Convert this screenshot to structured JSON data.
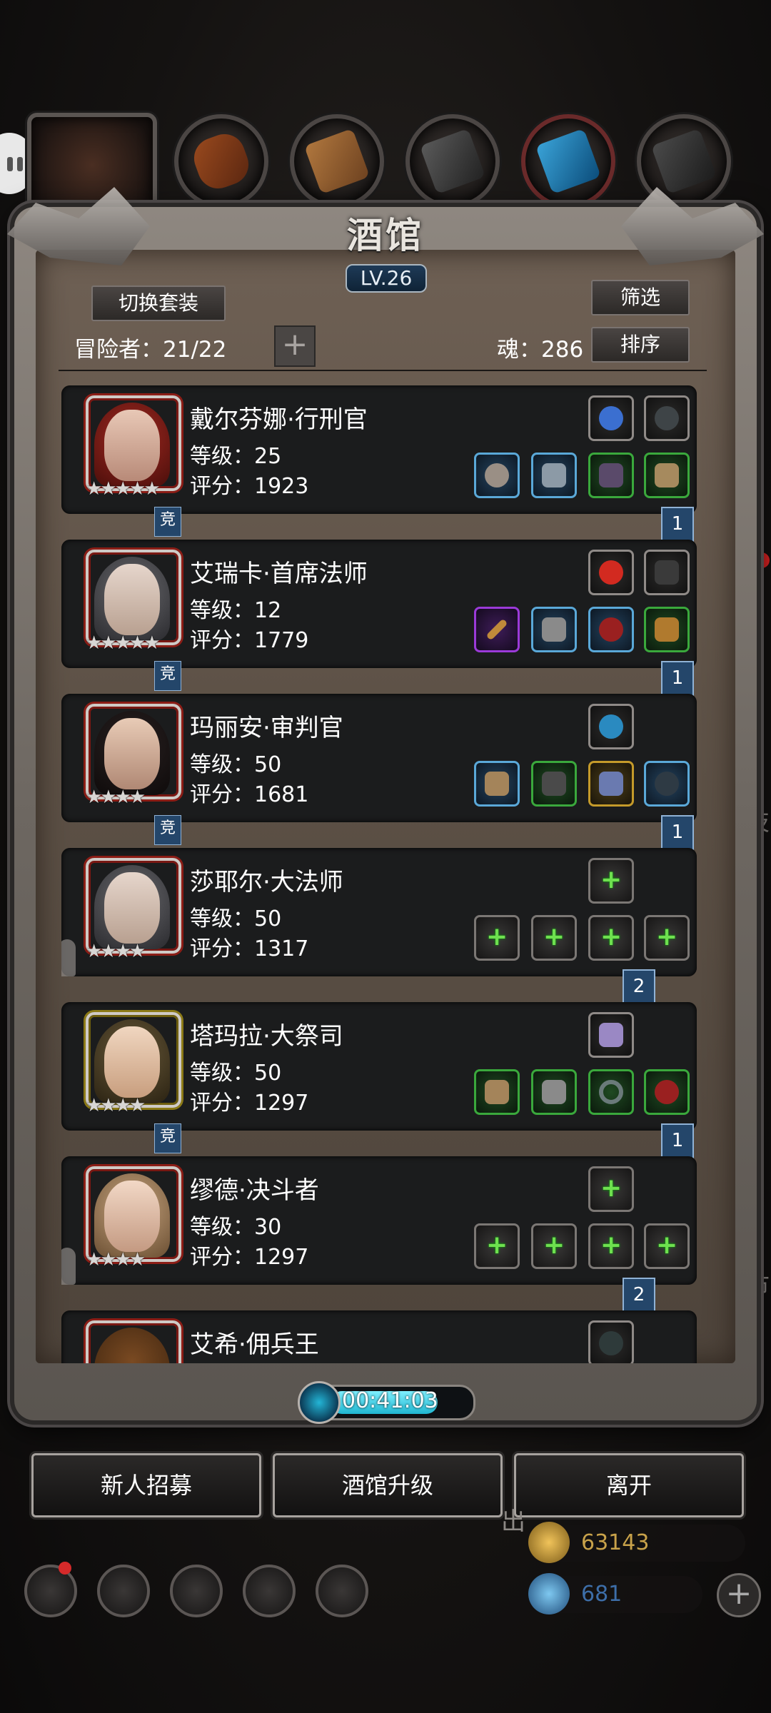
{
  "panel": {
    "title": "酒馆",
    "level": "LV.26",
    "switch_outfit": "切换套装",
    "filter": "筛选",
    "sort": "排序",
    "adventurers_label": "冒险者：21/22",
    "soul_label": "魂：286"
  },
  "heroes": [
    {
      "name": "戴尔芬娜·行刑官",
      "level": "等级：25",
      "score": "评分：1923",
      "stars": "★★★★★",
      "badge": "竞",
      "ribbon": "1"
    },
    {
      "name": "艾瑞卡·首席法师",
      "level": "等级：12",
      "score": "评分：1779",
      "stars": "★★★★★",
      "badge": "竞",
      "ribbon": "1"
    },
    {
      "name": "玛丽安·审判官",
      "level": "等级：50",
      "score": "评分：1681",
      "stars": "★★★★",
      "badge": "竞",
      "ribbon": "1"
    },
    {
      "name": "莎耶尔·大法师",
      "level": "等级：50",
      "score": "评分：1317",
      "stars": "★★★★",
      "badge": "",
      "ribbon": "2"
    },
    {
      "name": "塔玛拉·大祭司",
      "level": "等级：50",
      "score": "评分：1297",
      "stars": "★★★★",
      "badge": "竞",
      "ribbon": "1"
    },
    {
      "name": "缪德·决斗者",
      "level": "等级：30",
      "score": "评分：1297",
      "stars": "★★★★",
      "badge": "",
      "ribbon": "2"
    },
    {
      "name": "艾希·佣兵王",
      "level": "",
      "score": "",
      "stars": "",
      "badge": "",
      "ribbon": ""
    }
  ],
  "timer": "00:41:03",
  "buttons": {
    "recruit": "新人招募",
    "upgrade": "酒馆升级",
    "leave": "离开"
  },
  "resources": {
    "gold": "63143",
    "gems": "681"
  },
  "side_labels": {
    "skill": "技",
    "market": "市",
    "out": "出"
  },
  "colors": {
    "gold_text": "#c8a24a",
    "gem_text": "#3d6ea8",
    "ribbon": "#24466a",
    "add_plus": "#6ee04f"
  }
}
